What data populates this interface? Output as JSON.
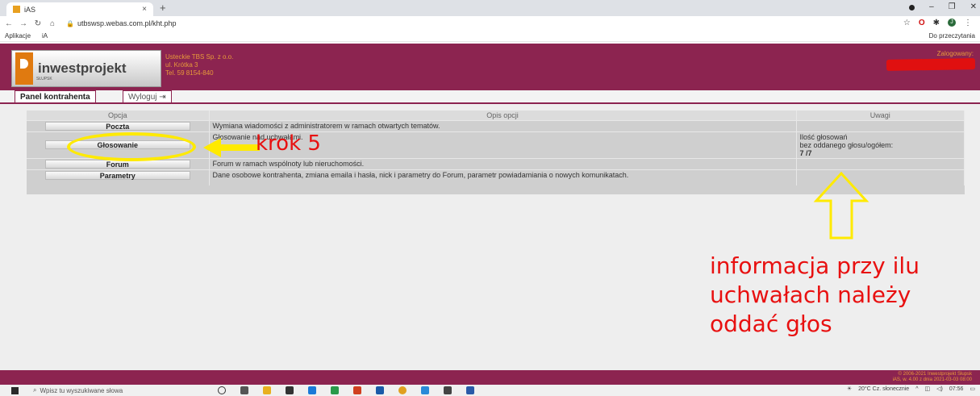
{
  "browser": {
    "tab_title": "iAS",
    "tab_close": "×",
    "new_tab": "+",
    "url": "utbswsp.webas.com.pl/kht.php",
    "bookmarks": [
      "Aplikacje",
      "iA"
    ],
    "bookmarks_right": "Do przeczytania"
  },
  "header": {
    "logo_text": "inwestprojekt",
    "logo_sub": "SŁUPSK",
    "company_lines": [
      "Usteckie TBS Sp. z o.o.",
      "ul. Krótka 3",
      "Tel. 59 8154-840"
    ],
    "logged_label": "Zalogowany:"
  },
  "tabs": {
    "panel": "Panel kontrahenta",
    "logout": "Wyloguj"
  },
  "table": {
    "headers": [
      "Opcja",
      "Opis opcji",
      "Uwagi"
    ],
    "rows": [
      {
        "button": "Poczta",
        "desc": "Wymiana wiadomości z administratorem w ramach otwartych tematów.",
        "note": ""
      },
      {
        "button": "Głosowanie",
        "desc": "Głosowanie nad uchwałami.",
        "note_lines": [
          "Ilość głosowań",
          "bez oddanego głosu/ogółem:",
          "7 /7"
        ]
      },
      {
        "button": "Forum",
        "desc": "Forum w ramach wspólnoty lub nieruchomości.",
        "note": ""
      },
      {
        "button": "Parametry",
        "desc": "Dane osobowe kontrahenta, zmiana emaila i hasła, nick i parametry do Forum, parametr powiadamiania o nowych komunikatach.",
        "note": ""
      }
    ]
  },
  "annotations": {
    "krok": "krok 5",
    "info_lines": [
      "informacja przy ilu",
      "uchwałach należy",
      "oddać głos"
    ]
  },
  "footer": {
    "copyright": "© 2006-2021 Inwestprojekt Słupsk",
    "version": "iAS, w. 4.00 z dnia 2021-03-03 08:00"
  },
  "taskbar": {
    "search_placeholder": "Wpisz tu wyszukiwane słowa",
    "weather": "20°C Cz. słonecznie",
    "time": "07:56"
  },
  "colors": {
    "brand": "#8c2450",
    "accent": "#e79a3a",
    "annotation_yellow": "#ffea00",
    "annotation_red": "#e81010"
  }
}
